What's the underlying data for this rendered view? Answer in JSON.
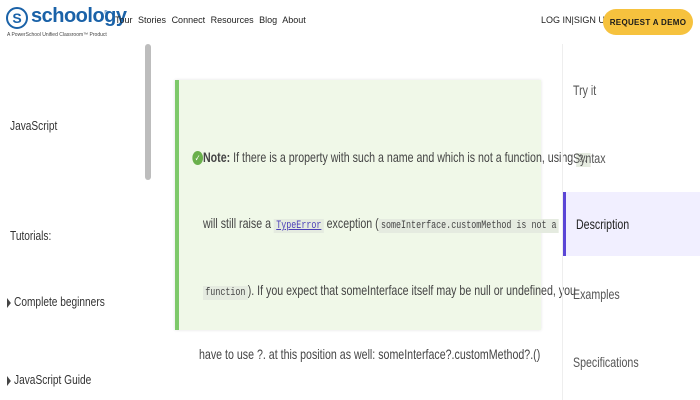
{
  "header": {
    "logo_mark": "S",
    "logo_word": "schoology",
    "logo_tm": "®",
    "logo_tagline": "A PowerSchool Unified Classroom™ Product",
    "nav": [
      "Tour",
      "Stories",
      "Connect",
      "Resources",
      "Blog",
      "About"
    ],
    "login": "LOG IN",
    "separator": "|",
    "signup": "SIGN UP",
    "demo_button": "REQUEST A DEMO"
  },
  "left_sidebar": {
    "section": "JavaScript",
    "tutorials_label": "Tutorials:",
    "items": [
      "Complete beginners",
      "JavaScript Guide"
    ]
  },
  "note": {
    "label": "Note:",
    "line1": "If there is a property with such a name and which is not a function, using",
    "line1_code": "?.",
    "line2_prefix": "will still raise a",
    "line2_link": "TypeError",
    "line2_mid": "exception (",
    "line2_code": "someInterface.customMethod is not a",
    "line3_code": "function",
    "line3_text": "). If you expect that someInterface itself may be null or undefined, you",
    "line4": "have to use ?. at this position as well: someInterface?.customMethod?.()"
  },
  "right_nav": {
    "items": [
      "Try it",
      "Syntax",
      "Description",
      "Examples",
      "Specifications"
    ],
    "active": "Description"
  },
  "colors": {
    "accent": "#f6c23e",
    "brand": "#1a62a8",
    "note_bg": "#f0f8e8",
    "note_border": "#7ec96a",
    "active_border": "#5b46d6"
  }
}
